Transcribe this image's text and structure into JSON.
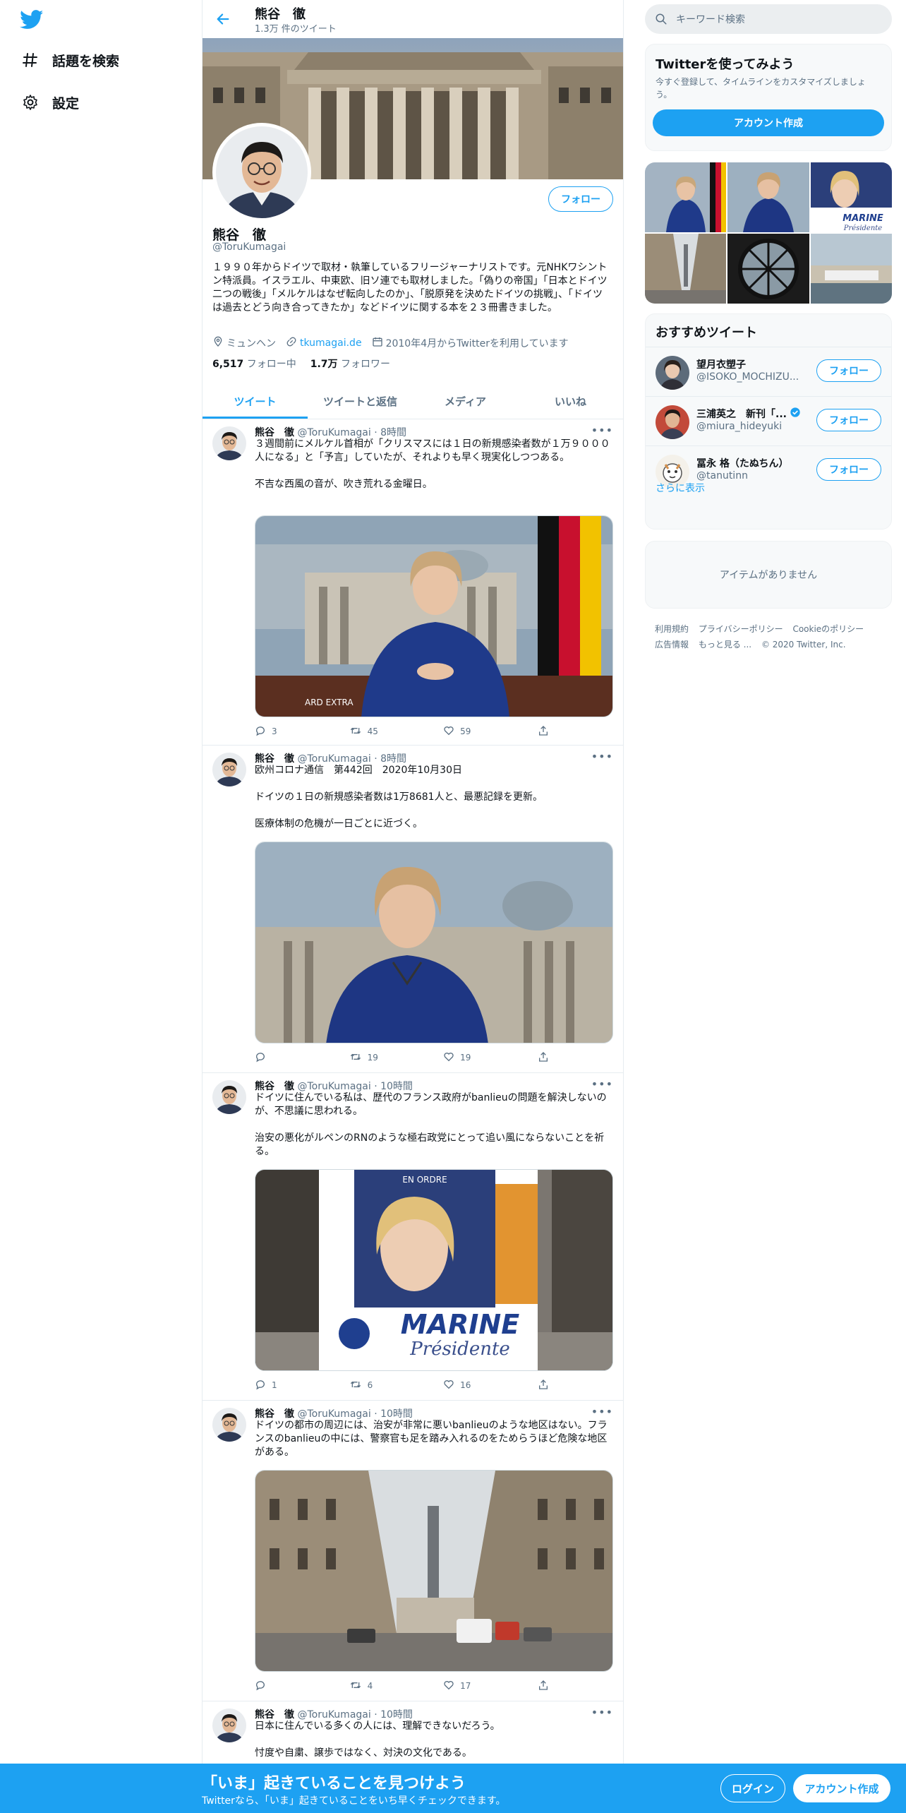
{
  "nav": {
    "logo": "twitter-logo",
    "items": [
      {
        "icon": "hashtag-icon",
        "label": "話題を検索"
      },
      {
        "icon": "gear-icon",
        "label": "設定"
      }
    ]
  },
  "profile_header": {
    "name": "熊谷　徹",
    "tweet_count": "1.3万 件のツイート"
  },
  "profile": {
    "name": "熊谷　徹",
    "handle": "@ToruKumagai",
    "follow_label": "フォロー",
    "bio": "１９９０年からドイツで取材・執筆しているフリージャーナリストです。元NHKワシントン特派員。イスラエル、中東欧、旧ソ連でも取材しました。「偽りの帝国」「日本とドイツ　二つの戦後」「メルケルはなぜ転向したのか」、「脱原発を決めたドイツの挑戦」、「ドイツは過去とどう向き合ってきたか」などドイツに関する本を２３冊書きました。",
    "location": "ミュンヘン",
    "website": "tkumagai.de",
    "joined": "2010年4月からTwitterを利用しています",
    "following_count": "6,517",
    "following_label": "フォロー中",
    "followers_count": "1.7万",
    "followers_label": "フォロワー"
  },
  "tabs": [
    "ツイート",
    "ツイートと返信",
    "メディア",
    "いいね"
  ],
  "tweets": [
    {
      "name": "熊谷　徹",
      "handle": "@ToruKumagai",
      "time": "8時間",
      "text": "３週間前にメルケル首相が「クリスマスには１日の新規感染者数が１万９０００人になる」と「予言」していたが、それよりも早く現実化しつつある。\n\n不吉な西風の音が、吹き荒れる金曜日。",
      "media": "merkel-address-1",
      "watermark": "ARD EXTRA",
      "replies": "3",
      "retweets": "45",
      "likes": "59"
    },
    {
      "name": "熊谷　徹",
      "handle": "@ToruKumagai",
      "time": "8時間",
      "text": "欧州コロナ通信　第442回　2020年10月30日\n\nドイツの１日の新規感染者数は1万8681人と、最悪記録を更新。\n\n医療体制の危機が一日ごとに近づく。",
      "media": "merkel-address-2",
      "replies": "",
      "retweets": "19",
      "likes": "19"
    },
    {
      "name": "熊谷　徹",
      "handle": "@ToruKumagai",
      "time": "10時間",
      "text": "ドイツに住んでいる私は、歴代のフランス政府がbanlieuの問題を解決しないのが、不思議に思われる。\n\n治安の悪化がルペンのRNのような極右政党にとって追い風にならないことを祈る。",
      "media": "marine-poster",
      "poster_top": "EN ORDRE",
      "poster_main": "MARINE",
      "poster_sub": "Présidente",
      "replies": "1",
      "retweets": "6",
      "likes": "16"
    },
    {
      "name": "熊谷　徹",
      "handle": "@ToruKumagai",
      "time": "10時間",
      "text": "ドイツの都市の周辺には、治安が非常に悪いbanlieuのような地区はない。フランスのbanlieuの中には、警察官も足を踏み入れるのをためらうほど危険な地区がある。",
      "media": "paris-street",
      "replies": "",
      "retweets": "4",
      "likes": "17"
    },
    {
      "name": "熊谷　徹",
      "handle": "@ToruKumagai",
      "time": "10時間",
      "text": "日本に住んでいる多くの人には、理解できないだろう。\n\n忖度や自粛、譲歩ではなく、対決の文化である。"
    }
  ],
  "right": {
    "search_placeholder": "キーワード検索",
    "signup_title": "Twitterを使ってみよう",
    "signup_text": "今すぐ登録して、タイムラインをカスタマイズしましょう。",
    "signup_button": "アカウント作成",
    "photo_grid_caption": "MARINE Présidente",
    "recommended_title": "おすすめツイート",
    "recommended": [
      {
        "name": "望月衣塑子",
        "handle": "@ISOKO_MOCHIZU...",
        "verified": false
      },
      {
        "name": "三浦英之　新刊「...",
        "handle": "@miura_hideyuki",
        "verified": true
      },
      {
        "name": "冨永 格（たぬちん）",
        "handle": "@tanutinn",
        "verified": false
      }
    ],
    "recommended_follow": "フォロー",
    "show_more": "さらに表示",
    "no_items": "アイテムがありません",
    "footer_links": [
      "利用規約",
      "プライバシーポリシー",
      "Cookieのポリシー",
      "広告情報",
      "もっと見る ...",
      "© 2020 Twitter, Inc."
    ]
  },
  "bottom_bar": {
    "title": "「いま」起きていることを見つけよう",
    "subtitle": "Twitterなら、「いま」起きていることをいち早くチェックできます。",
    "login": "ログイン",
    "signup": "アカウント作成"
  },
  "colors": {
    "accent": "#1da1f2",
    "text": "#0f1419",
    "muted": "#5b7083",
    "border": "#e6ecf0"
  }
}
